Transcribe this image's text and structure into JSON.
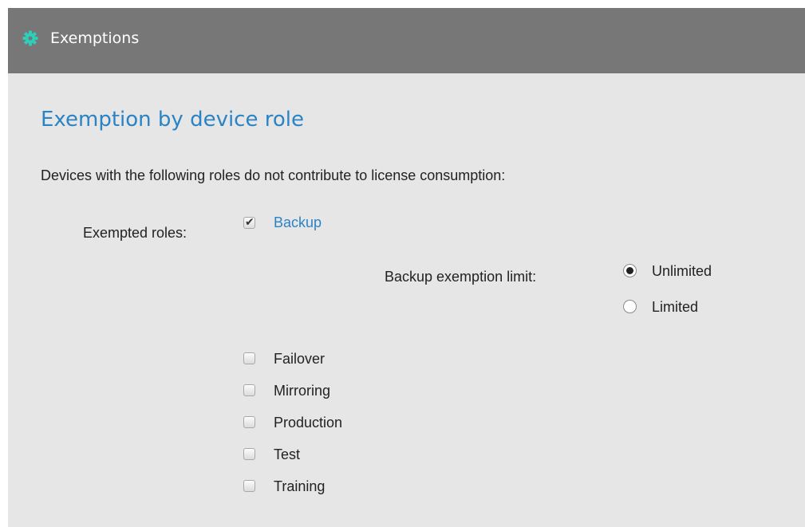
{
  "header": {
    "title": "Exemptions",
    "icon": "gear-icon",
    "icon_color": "#2ecfb8",
    "background": "#777777"
  },
  "section": {
    "title": "Exemption by device role",
    "description": "Devices with the following roles do not contribute to license consumption:"
  },
  "roles": {
    "label": "Exempted roles:",
    "items": [
      {
        "label": "Backup",
        "checked": true
      },
      {
        "label": "Failover",
        "checked": false
      },
      {
        "label": "Mirroring",
        "checked": false
      },
      {
        "label": "Production",
        "checked": false
      },
      {
        "label": "Test",
        "checked": false
      },
      {
        "label": "Training",
        "checked": false
      }
    ]
  },
  "backup_limit": {
    "label": "Backup exemption limit:",
    "options": [
      {
        "label": "Unlimited",
        "selected": true
      },
      {
        "label": "Limited",
        "selected": false
      }
    ]
  },
  "colors": {
    "panel_background": "#e6e6e6",
    "accent": "#2a83c5",
    "text": "#222222"
  }
}
